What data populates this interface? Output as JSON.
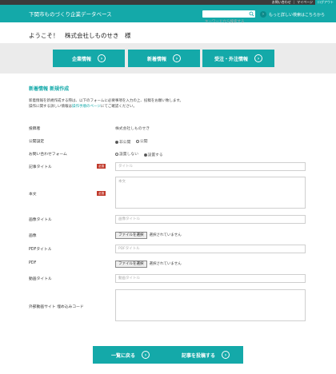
{
  "topbar": {
    "contact": "お問い合わせ",
    "separator": "|",
    "mypage": "マイページ",
    "logout": "ログアウト"
  },
  "header": {
    "title": "下関市ものづくり企業データベース",
    "search_placeholder": "キーワードから検索する",
    "more_link": "もっと詳しい検索はこちらから"
  },
  "welcome": "ようこそ！　株式会社しものせき　様",
  "nav": [
    {
      "label": "企業情報"
    },
    {
      "label": "新着情報"
    },
    {
      "label": "受注・外注情報"
    }
  ],
  "section_title": "新着情報 新規作成",
  "desc": {
    "line1": "新着情報を新規作成する際は、以下のフォームに必要事項を入力の上、投稿をお願い致します。",
    "line2_pre": "操作に関する詳しい情報は",
    "line2_link": "操作手順のページ",
    "line2_post": "にてご確認ください。"
  },
  "form": {
    "required_badge": "必須",
    "poster": {
      "label": "投稿者",
      "value": "株式会社しものせき"
    },
    "visibility": {
      "label": "公開設定",
      "options": [
        "非公開",
        "公開"
      ],
      "selected": 0
    },
    "contact_form": {
      "label": "お問い合わせフォーム",
      "options": [
        "設置しない",
        "設置する"
      ],
      "selected": 1
    },
    "article_title": {
      "label": "記事タイトル",
      "placeholder": "タイトル"
    },
    "body": {
      "label": "本文",
      "placeholder": "本文"
    },
    "image_title": {
      "label": "画像タイトル",
      "placeholder": "画像タイトル"
    },
    "image": {
      "label": "画像",
      "button": "ファイルを選択",
      "status": "選択されていません"
    },
    "pdf_title": {
      "label": "PDFタイトル",
      "placeholder": "PDFタイトル"
    },
    "pdf": {
      "label": "PDF",
      "button": "ファイルを選択",
      "status": "選択されていません"
    },
    "video_title": {
      "label": "動画タイトル",
      "placeholder": "動画タイトル"
    },
    "embed_code": {
      "label": "外部動画サイト 埋め込みコード",
      "placeholder": ""
    }
  },
  "buttons": {
    "back": "一覧に戻る",
    "submit": "記事を投稿する"
  },
  "colors": {
    "accent": "#14a9a9",
    "required": "#c0392b",
    "topbar": "#3b3b3b"
  }
}
